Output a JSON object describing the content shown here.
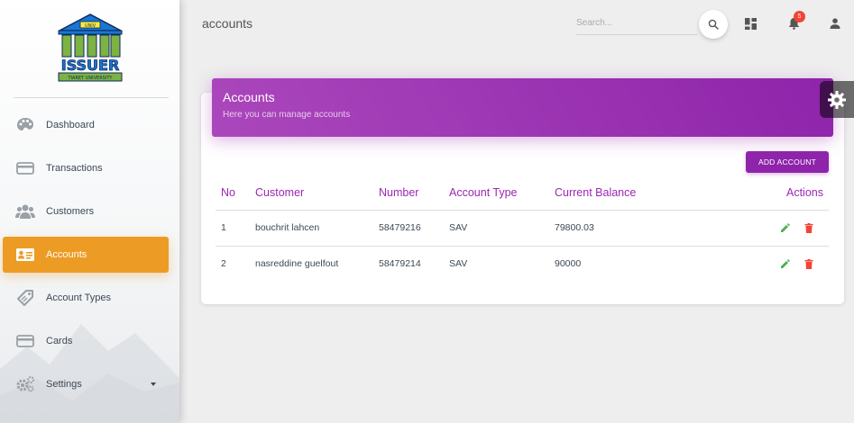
{
  "logo": {
    "text": "ISSUER",
    "subtext": "TIARET UNIVERSITY",
    "roof_text": "UNIV"
  },
  "sidebar": {
    "items": [
      {
        "label": "Dashboard",
        "icon": "palette-icon"
      },
      {
        "label": "Transactions",
        "icon": "credit-card-icon"
      },
      {
        "label": "Customers",
        "icon": "people-icon"
      },
      {
        "label": "Accounts",
        "icon": "id-card-icon",
        "active": true
      },
      {
        "label": "Account Types",
        "icon": "tag-icon"
      },
      {
        "label": "Cards",
        "icon": "card-icon"
      },
      {
        "label": "Settings",
        "icon": "gears-icon",
        "has_caret": true
      }
    ],
    "active_color": "#ec9c24"
  },
  "header": {
    "title": "accounts",
    "search_placeholder": "Search...",
    "notification_count": "5"
  },
  "card": {
    "title": "Accounts",
    "subtitle": "Here you can manage accounts",
    "add_button": "ADD ACCOUNT",
    "header_color": "#8e24aa"
  },
  "table": {
    "columns": [
      "No",
      "Customer",
      "Number",
      "Account Type",
      "Current Balance",
      "Actions"
    ],
    "rows": [
      {
        "no": "1",
        "customer": "bouchrit lahcen",
        "number": "58479216",
        "type": "SAV",
        "balance": "79800.03"
      },
      {
        "no": "2",
        "customer": "nasreddine guelfout",
        "number": "58479214",
        "type": "SAV",
        "balance": "90000"
      }
    ]
  },
  "colors": {
    "edit": "#4caf50",
    "delete": "#f44336",
    "column_header": "#9c27b0"
  }
}
